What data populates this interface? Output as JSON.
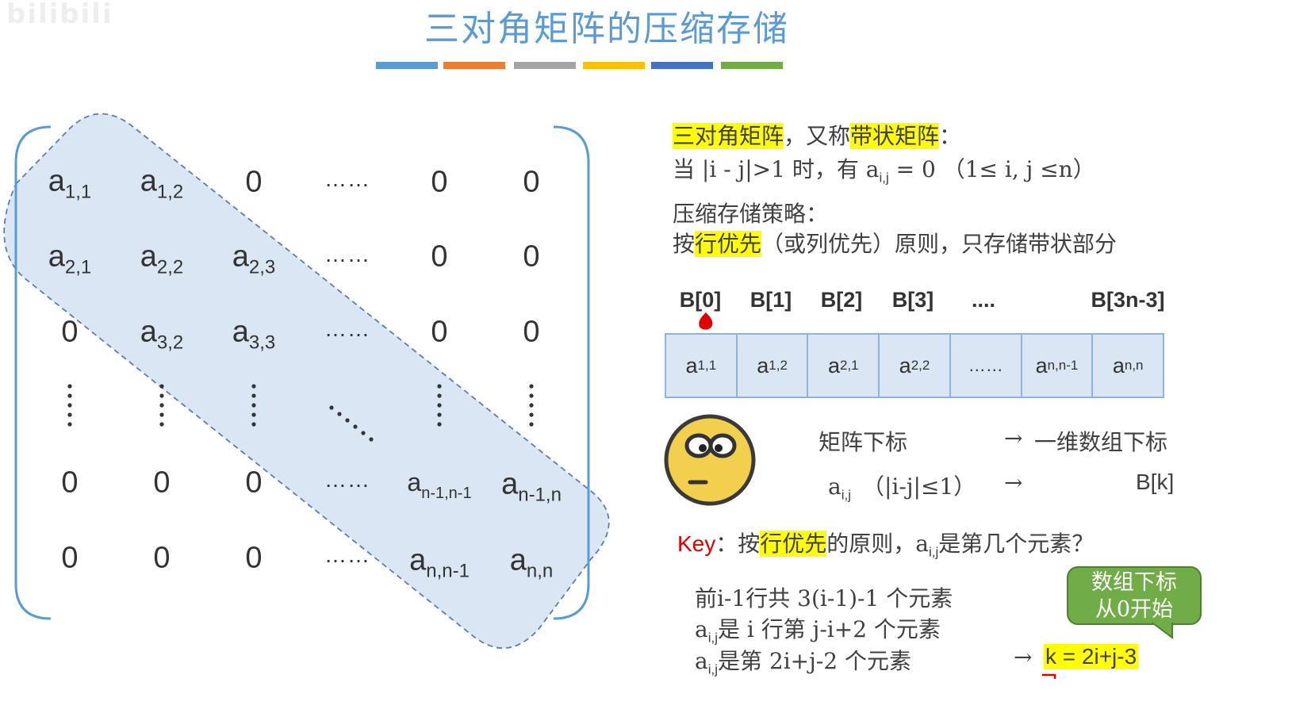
{
  "title": "三对角矩阵的压缩存储",
  "color_bars": [
    "#5b9bd5",
    "#ed7d31",
    "#a5a5a5",
    "#ffc000",
    "#4472c4",
    "#70ad47"
  ],
  "matrix": {
    "r1": {
      "c1": "a",
      "c1s": "1,1",
      "c2": "a",
      "c2s": "1,2",
      "c3": "0",
      "c4": "……",
      "c5": "0",
      "c6": "0"
    },
    "r2": {
      "c1": "a",
      "c1s": "2,1",
      "c2": "a",
      "c2s": "2,2",
      "c3": "a",
      "c3s": "2,3",
      "c4": "……",
      "c5": "0",
      "c6": "0"
    },
    "r3": {
      "c1": "0",
      "c2": "a",
      "c2s": "3,2",
      "c3": "a",
      "c3s": "3,3",
      "c4": "……",
      "c5": "0",
      "c6": "0"
    },
    "r5": {
      "c1": "0",
      "c2": "0",
      "c3": "0",
      "c4": "……",
      "c5": "a",
      "c5s": "n-1,n-1",
      "c6": "a",
      "c6s": "n-1,n"
    },
    "r6": {
      "c1": "0",
      "c2": "0",
      "c3": "0",
      "c4": "……",
      "c5": "a",
      "c5s": "n,n-1",
      "c6": "a",
      "c6s": "n,n"
    }
  },
  "intro": {
    "term1": "三对角矩阵",
    "mid1": "，又称",
    "term2": "带状矩阵",
    "colon": "：",
    "cond_prefix": "当 |i - j|>1 时，有 a",
    "cond_sub": "i,j",
    "cond_suffix": " = 0 （1≤ i, j ≤n）",
    "strategy_title": "压缩存储策略：",
    "strategy_prefix": "按",
    "strategy_hl": "行优先",
    "strategy_suffix": "（或列优先）原则，只存储带状部分"
  },
  "array_indices": [
    "B[0]",
    "B[1]",
    "B[2]",
    "B[3]",
    "....",
    "B[3n-3]"
  ],
  "array_cells": [
    {
      "base": "a",
      "sub": "1,1"
    },
    {
      "base": "a",
      "sub": "1,2"
    },
    {
      "base": "a",
      "sub": "2,1"
    },
    {
      "base": "a",
      "sub": "2,2"
    },
    {
      "base": "……",
      "sub": ""
    },
    {
      "base": "a",
      "sub": "n,n-1"
    },
    {
      "base": "a",
      "sub": "n,n"
    }
  ],
  "mapping": {
    "left_label": "矩阵下标",
    "arrow": "→",
    "right_label": "一维数组下标",
    "elem_base": "a",
    "elem_sub": "i,j",
    "elem_cond": "（|i-j|≤1）",
    "target": "B[k]"
  },
  "key": {
    "label": "Key",
    "colon": "：",
    "prefix": "按",
    "hl": "行优先",
    "mid": "的原则，a",
    "sub": "i,j",
    "suffix": "是第几个元素？"
  },
  "steps": {
    "s1": "前i-1行共 3(i-1)-1 个元素",
    "s2_base": "a",
    "s2_sub": "i,j",
    "s2_text": "是 i 行第 j-i+2 个元素",
    "s3_base": "a",
    "s3_sub": "i,j",
    "s3_text": "是第 2i+j-2 个元素",
    "arrow": "→",
    "formula": "k = 2i+j-3"
  },
  "bubble": {
    "line1": "数组下标",
    "line2": "从0开始"
  },
  "watermark": "bilibili"
}
